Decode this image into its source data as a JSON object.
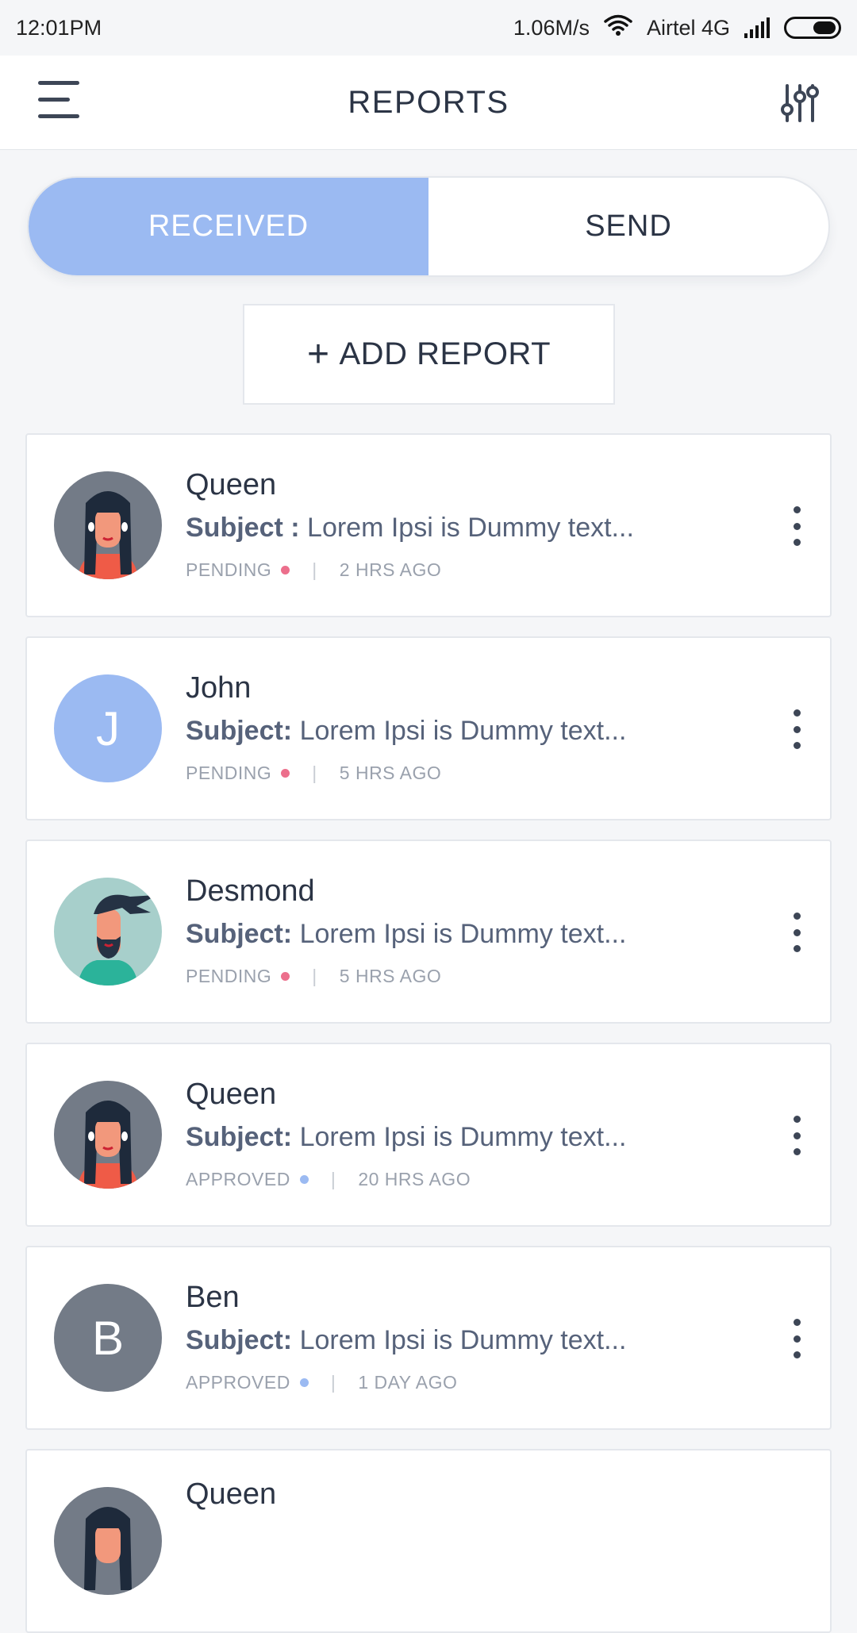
{
  "status_bar": {
    "time": "12:01PM",
    "speed": "1.06M/s",
    "carrier": "Airtel 4G",
    "icons": [
      "wifi-icon",
      "signal-icon",
      "battery-icon"
    ]
  },
  "header": {
    "title": "REPORTS",
    "left_icon": "hamburger-menu-icon",
    "right_icon": "filter-sliders-icon"
  },
  "tabs": {
    "received_label": "RECEIVED",
    "send_label": "SEND",
    "active": "RECEIVED"
  },
  "add_report": {
    "icon": "+",
    "label": "ADD REPORT"
  },
  "colors": {
    "accent": "#9bbaf2",
    "pending_dot": "#ec6f8c",
    "approved_dot": "#9bbaf2",
    "avatar_gray": "#737b87",
    "avatar_teal": "#a7cfcb"
  },
  "reports": [
    {
      "name": "Queen",
      "subject_label": "Subject :",
      "subject_text": "Lorem Ipsi is Dummy text...",
      "status": "PENDING",
      "time": "2 HRS AGO",
      "avatar_initial": ""
    },
    {
      "name": "John",
      "subject_label": "Subject:",
      "subject_text": "Lorem Ipsi is Dummy text...",
      "status": "PENDING",
      "time": "5 HRS AGO",
      "avatar_initial": "J"
    },
    {
      "name": "Desmond",
      "subject_label": "Subject:",
      "subject_text": "Lorem Ipsi is Dummy text...",
      "status": "PENDING",
      "time": "5 HRS AGO",
      "avatar_initial": ""
    },
    {
      "name": "Queen",
      "subject_label": "Subject:",
      "subject_text": "Lorem Ipsi is Dummy text...",
      "status": "APPROVED",
      "time": "20 HRS AGO",
      "avatar_initial": ""
    },
    {
      "name": "Ben",
      "subject_label": "Subject:",
      "subject_text": "Lorem Ipsi is Dummy text...",
      "status": "APPROVED",
      "time": "1 DAY AGO",
      "avatar_initial": "B"
    },
    {
      "name": "Queen"
    }
  ]
}
